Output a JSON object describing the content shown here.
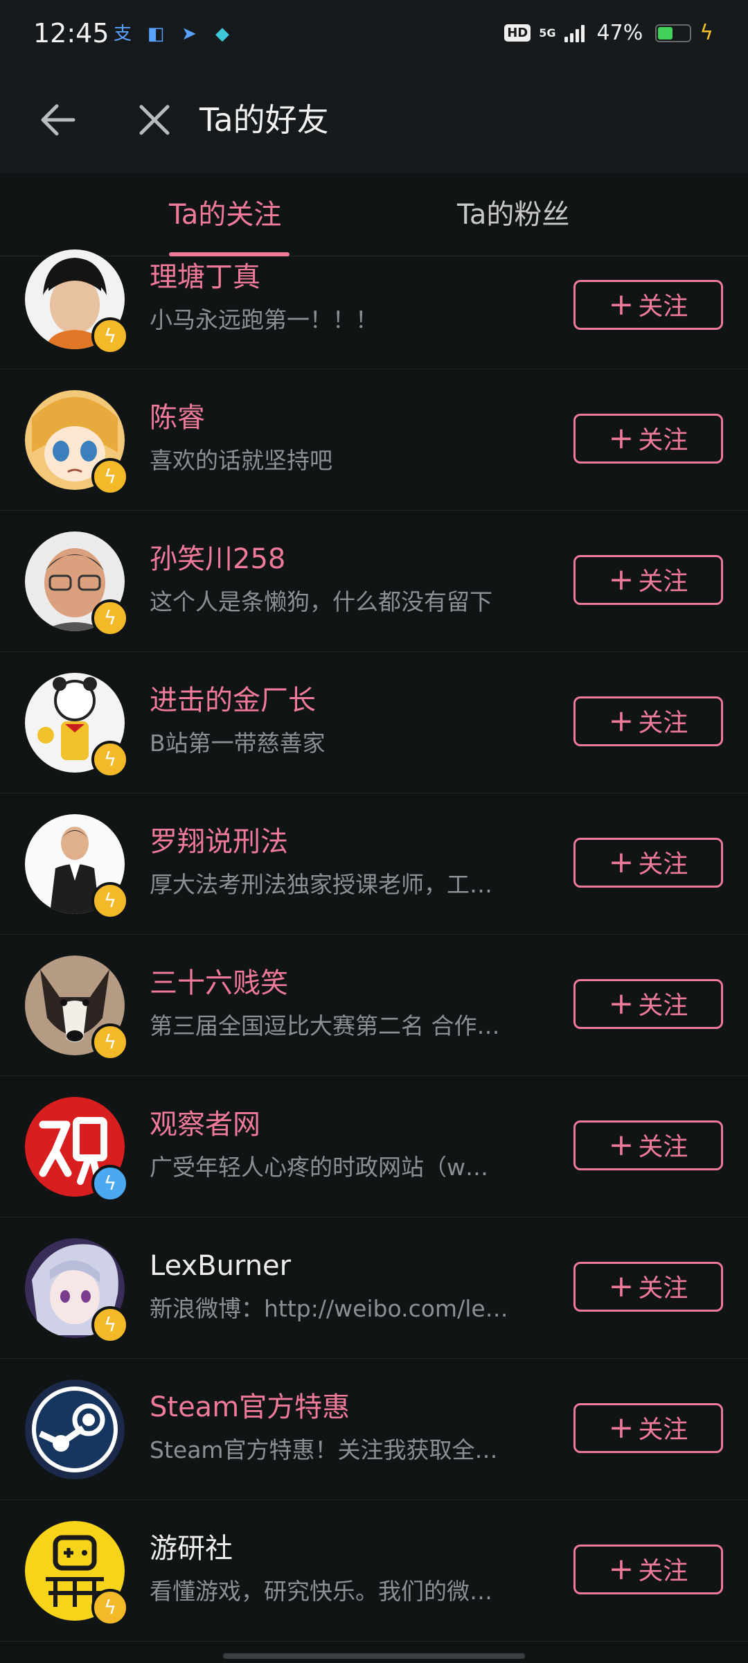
{
  "status_bar": {
    "time": "12:45",
    "network": "5G",
    "hd_label": "HD",
    "battery_text": "47%",
    "battery_level": 0.47,
    "colors": {
      "battery": "#42d15a",
      "charging": "#f3c12b"
    }
  },
  "header": {
    "title": "Ta的好友",
    "back_icon": "back-arrow-icon",
    "close_icon": "close-icon"
  },
  "tabs": [
    {
      "label": "Ta的关注",
      "active": true
    },
    {
      "label": "Ta的粉丝",
      "active": false
    }
  ],
  "follow_button_label": "关注",
  "users": [
    {
      "name": "理塘丁真",
      "desc": "小马永远跑第一！！！",
      "name_color": "white",
      "badge": "yellow"
    },
    {
      "name": "陈睿",
      "desc": "喜欢的话就坚持吧",
      "name_color": "pink",
      "badge": "yellow"
    },
    {
      "name": "孙笑川258",
      "desc": "这个人是条懒狗，什么都没有留下",
      "name_color": "pink",
      "badge": "yellow"
    },
    {
      "name": "进击的金厂长",
      "desc": "B站第一带慈善家",
      "name_color": "pink",
      "badge": "yellow"
    },
    {
      "name": "罗翔说刑法",
      "desc": "厚大法考刑法独家授课老师，工…",
      "name_color": "pink",
      "badge": "yellow"
    },
    {
      "name": "三十六贱笑",
      "desc": "第三届全国逗比大赛第二名 合作…",
      "name_color": "pink",
      "badge": "yellow"
    },
    {
      "name": "观察者网",
      "desc": "广受年轻人心疼的时政网站（w…",
      "name_color": "pink",
      "badge": "blue"
    },
    {
      "name": "LexBurner",
      "desc": "新浪微博：http://weibo.com/le…",
      "name_color": "white",
      "badge": "yellow"
    },
    {
      "name": "Steam官方特惠",
      "desc": "Steam官方特惠！关注我获取全…",
      "name_color": "pink",
      "badge": "none"
    },
    {
      "name": "游研社",
      "desc": "看懂游戏，研究快乐。我们的微…",
      "name_color": "white",
      "badge": "yellow"
    }
  ],
  "colors": {
    "accent": "#f07a9a",
    "background": "#111414",
    "secondary_text": "#8b9094"
  }
}
